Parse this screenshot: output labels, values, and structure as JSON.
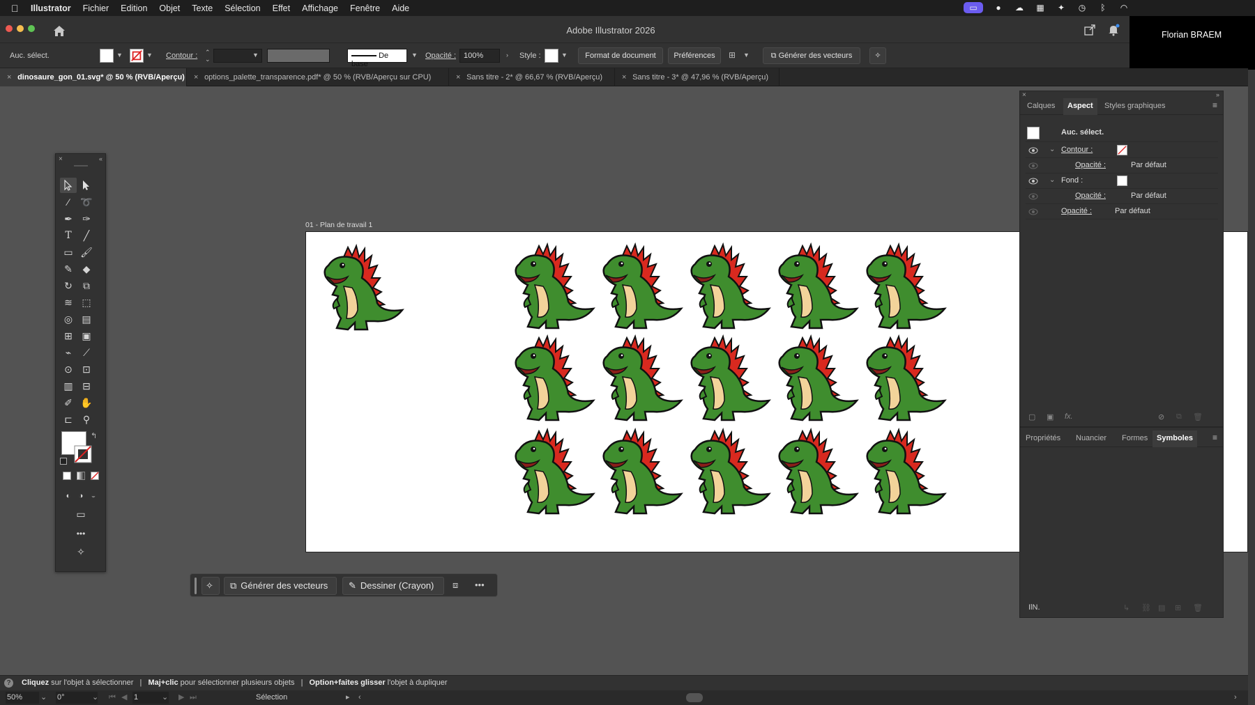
{
  "menubar": {
    "app_name": "Illustrator",
    "items": [
      "Fichier",
      "Edition",
      "Objet",
      "Texte",
      "Sélection",
      "Effet",
      "Affichage",
      "Fenêtre",
      "Aide"
    ]
  },
  "window": {
    "title": "Adobe Illustrator 2026"
  },
  "user": {
    "name": "Florian BRAEM"
  },
  "control_bar": {
    "selection_label": "Auc. sélect.",
    "contour_label": "Contour :",
    "stroke_profile": "De base",
    "opacity_label": "Opacité :",
    "opacity_value": "100%",
    "style_label": "Style :",
    "doc_format_button": "Format de document",
    "preferences_button": "Préférences",
    "generate_vectors_button": "Générer des vecteurs"
  },
  "tabs": [
    {
      "label": "dinosaure_gon_01.svg* @ 50 % (RVB/Aperçu)",
      "active": true
    },
    {
      "label": "options_palette_transparence.pdf* @ 50 % (RVB/Aperçu sur CPU)",
      "active": false
    },
    {
      "label": "Sans titre - 2* @ 66,67 % (RVB/Aperçu)",
      "active": false
    },
    {
      "label": "Sans titre - 3* @ 47,96 % (RVB/Aperçu)",
      "active": false
    }
  ],
  "artboard": {
    "label": "01 - Plan de travail 1"
  },
  "taskbar": {
    "generate_vectors": "Générer des vecteurs",
    "draw_pencil": "Dessiner (Crayon)",
    "more": "•••"
  },
  "toolbox": {
    "more": "•••"
  },
  "aspect_panel": {
    "tabs": [
      "Calques",
      "Aspect",
      "Styles graphiques"
    ],
    "active_tab": "Aspect",
    "header": "Auc. sélect.",
    "rows": [
      {
        "label": "Contour :",
        "value": ""
      },
      {
        "label": "Opacité :",
        "value": "Par défaut"
      },
      {
        "label": "Fond :",
        "value": ""
      },
      {
        "label": "Opacité :",
        "value": "Par défaut"
      },
      {
        "label": "Opacité :",
        "value": "Par défaut"
      }
    ],
    "fx": "fx."
  },
  "symbols_panel": {
    "tabs": [
      "Propriétés",
      "Nuancier",
      "Formes",
      "Symboles"
    ],
    "active_tab": "Symboles",
    "library_icon": "IlN."
  },
  "hint_bar": {
    "p1_bold": "Cliquez",
    "p1": " sur l'objet à sélectionner",
    "sep": "|",
    "p2_bold": "Maj+clic",
    "p2": " pour sélectionner plusieurs objets",
    "p3_bold": "Option+faites glisser",
    "p3": " l'objet à dupliquer"
  },
  "status_bar": {
    "zoom": "50%",
    "rotation": "0°",
    "artboard_num": "1",
    "tool": "Sélection"
  },
  "colors": {
    "ui_dark": "#323232",
    "canvas": "#535353",
    "dino_green": "#3f8d2e",
    "dino_spikes": "#d8291f",
    "accent_purple": "#6b5cf0"
  }
}
